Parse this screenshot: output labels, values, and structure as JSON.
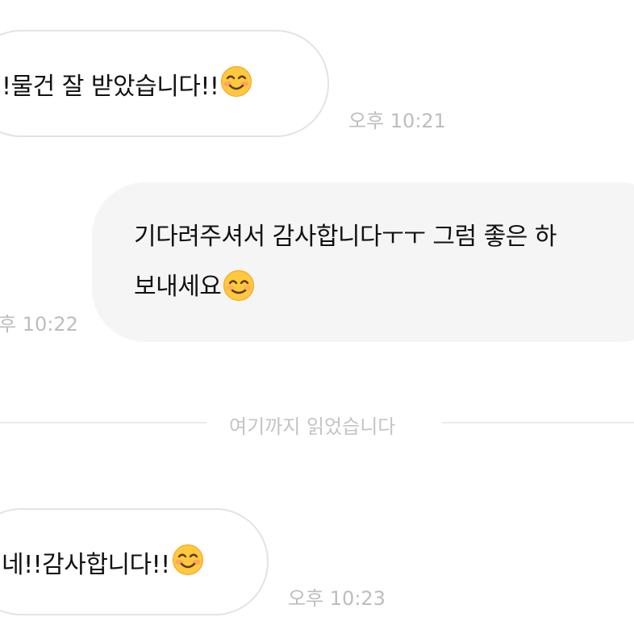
{
  "messages": [
    {
      "text": "!물건 잘 받았습니다!!",
      "emoji": "smiling-face-with-smiling-eyes-blush",
      "time": "오후 10:21",
      "side": "received"
    },
    {
      "line1": "기다려주셔서 감사합니다ㅜㅜ 그럼 좋은 하",
      "line2": "보내세요",
      "emoji": "smiling-face",
      "time": "후 10:22",
      "side": "sent"
    },
    {
      "text": "네!!감사합니다!!",
      "emoji": "smiling-face-with-smiling-eyes-blush",
      "time": "오후 10:23",
      "side": "received"
    }
  ],
  "divider": {
    "text": "여기까지 읽었습니다"
  },
  "colors": {
    "sent_bubble": "#f5f5f5",
    "received_border": "#e3e3e3",
    "timestamp": "#bdbdbd",
    "emoji_face": "#ffc83d"
  }
}
